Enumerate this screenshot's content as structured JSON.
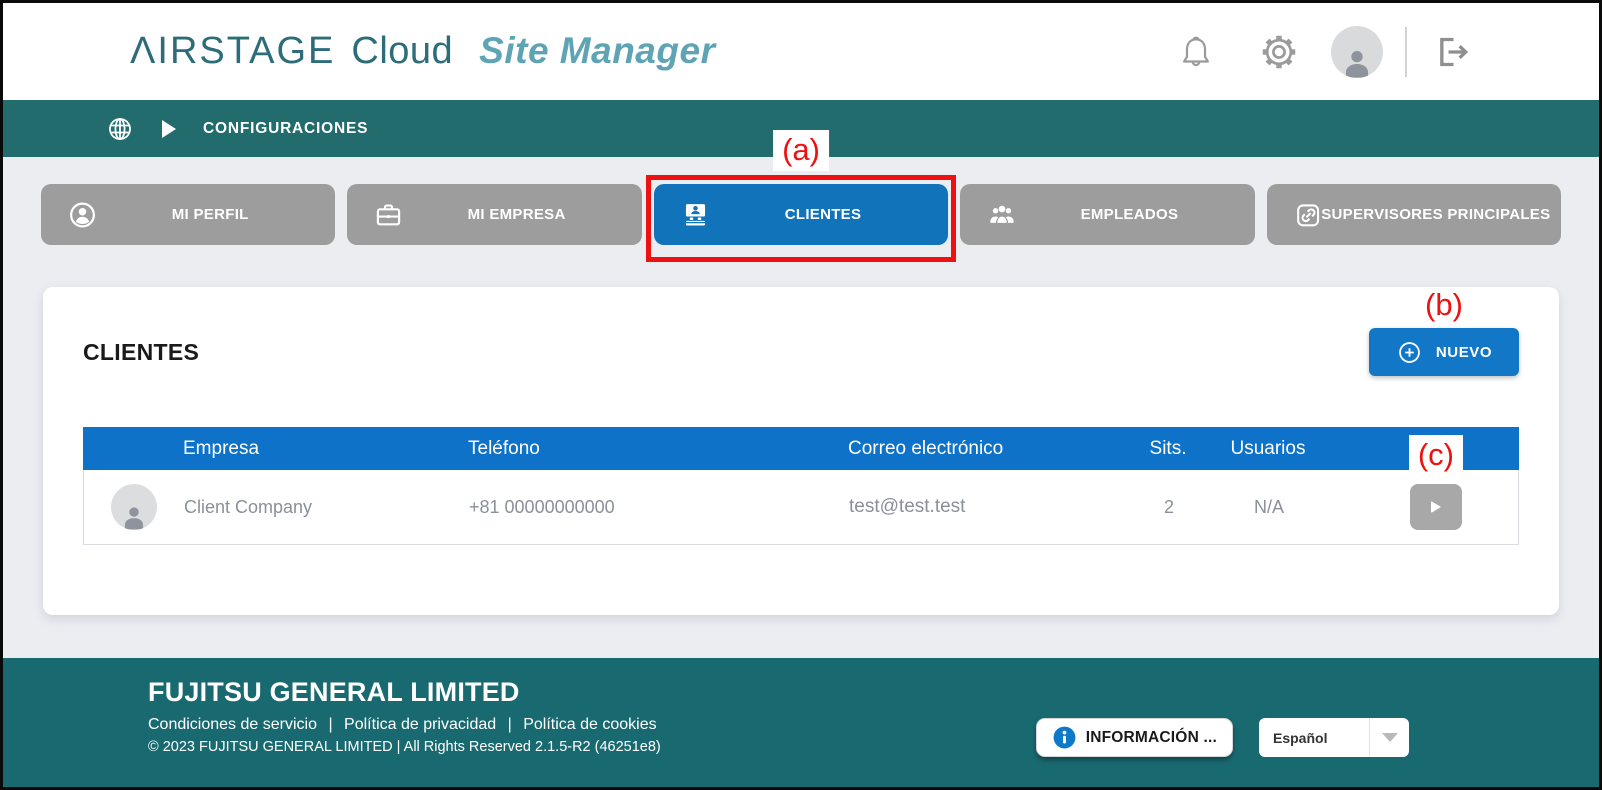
{
  "header": {
    "brand": {
      "airstage": "ΛIRSTAGE",
      "cloud": "Cloud",
      "product": "Site Manager"
    }
  },
  "breadcrumb": {
    "label": "CONFIGURACIONES"
  },
  "tabs": [
    {
      "label": "MI PERFIL"
    },
    {
      "label": "MI EMPRESA"
    },
    {
      "label": "CLIENTES"
    },
    {
      "label": "EMPLEADOS"
    },
    {
      "label": "SUPERVISORES PRINCIPALES"
    }
  ],
  "annotations": {
    "a": "(a)",
    "b": "(b)",
    "c": "(c)"
  },
  "clients_panel": {
    "title": "CLIENTES",
    "new_button_label": "NUEVO",
    "table": {
      "columns": {
        "empresa": "Empresa",
        "telefono": "Teléfono",
        "correo": "Correo electrónico",
        "sits": "Sits.",
        "usuarios": "Usuarios"
      },
      "rows": [
        {
          "empresa": "Client Company",
          "telefono": "+81 00000000000",
          "correo": "test@test.test",
          "sits": "2",
          "usuarios": "N/A"
        }
      ]
    }
  },
  "footer": {
    "company": "FUJITSU GENERAL LIMITED",
    "links": [
      "Condiciones de servicio",
      "Política de privacidad",
      "Política de cookies"
    ],
    "separator": "|",
    "copyright": "© 2023 FUJITSU GENERAL LIMITED | All Rights Reserved 2.1.5-R2 (46251e8)",
    "info_button_label": "INFORMACIÓN ...",
    "language_selected": "Español"
  },
  "icons": {
    "notifications": "bell-icon",
    "settings": "gear-icon",
    "account": "avatar-icon",
    "logout": "logout-icon",
    "language_globe": "globe-icon",
    "breadcrumb_arrow": "triangle-right-icon",
    "tab_mi_perfil": "person-circle-icon",
    "tab_mi_empresa": "briefcase-icon",
    "tab_clientes": "contact-badge-icon",
    "tab_empleados": "people-group-icon",
    "tab_supervisores": "chain-link-icon",
    "new": "plus-circle-icon",
    "row_action": "arrow-right-icon",
    "info": "info-circle-icon",
    "language_dropdown": "chevron-down-icon"
  },
  "colors": {
    "accent_blue": "#1173ba",
    "table_header_blue": "#0d72c8",
    "teal_bar": "#226c6e",
    "teal_footer": "#196a70",
    "tab_gray": "#9d9d9d",
    "annotation_red": "#ee1111"
  }
}
